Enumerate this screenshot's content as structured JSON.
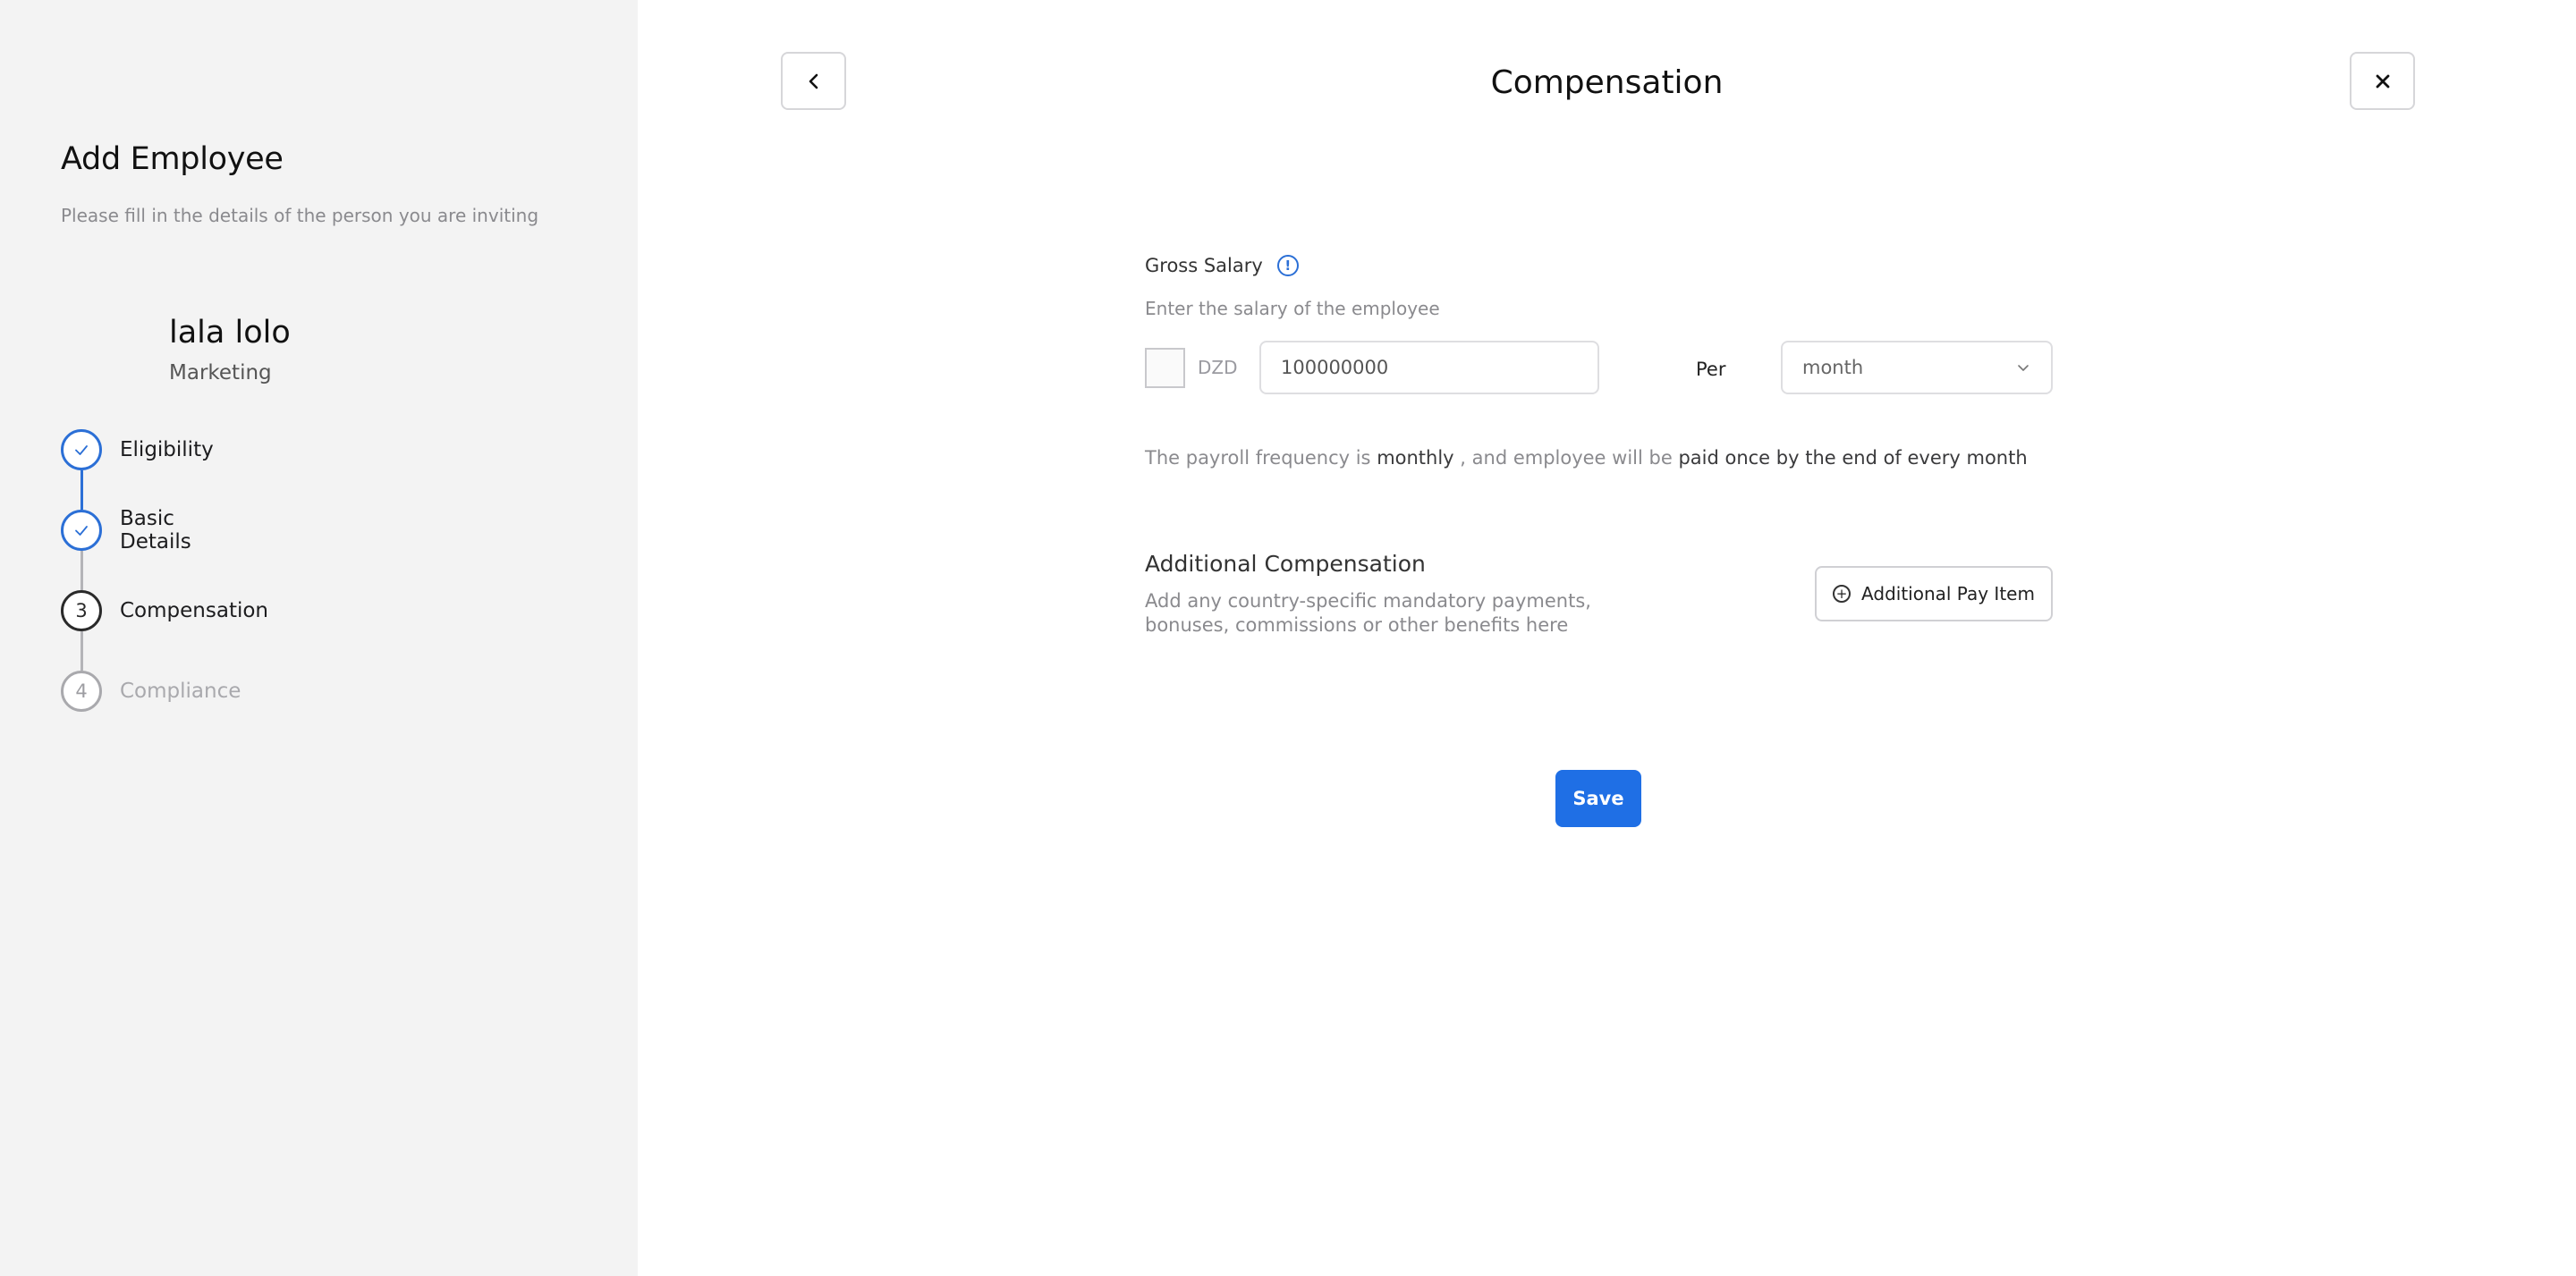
{
  "sidebar": {
    "title": "Add Employee",
    "subtitle": "Please fill in the details of the person you are inviting",
    "employee": {
      "name": "lala  lolo",
      "department": "Marketing"
    },
    "steps": [
      {
        "number": "1",
        "label": "Eligibility",
        "status": "done"
      },
      {
        "number": "2",
        "label": "Basic Details",
        "status": "done"
      },
      {
        "number": "3",
        "label": "Compensation",
        "status": "active"
      },
      {
        "number": "4",
        "label": "Compliance",
        "status": "pending"
      }
    ]
  },
  "header": {
    "title": "Compensation",
    "back_icon": "chevron-left-icon",
    "close_icon": "close-icon"
  },
  "salary": {
    "label": "Gross Salary",
    "hint": "Enter the salary of the employee",
    "currency": "DZD",
    "value": "100000000",
    "per_label": "Per",
    "period": "month"
  },
  "frequency": {
    "prefix": "The payroll frequency is ",
    "frequency": "monthly",
    "middle": " , and employee will be ",
    "schedule": "paid once by the end of every month"
  },
  "additional": {
    "title": "Additional Compensation",
    "description": "Add any country-specific mandatory payments, bonuses, commissions or other benefits here",
    "button_label": "Additional Pay Item"
  },
  "actions": {
    "save_label": "Save"
  },
  "colors": {
    "accent": "#1f6fe5",
    "sidebar_bg": "#f3f3f3",
    "step_done": "#2b6fd6"
  }
}
